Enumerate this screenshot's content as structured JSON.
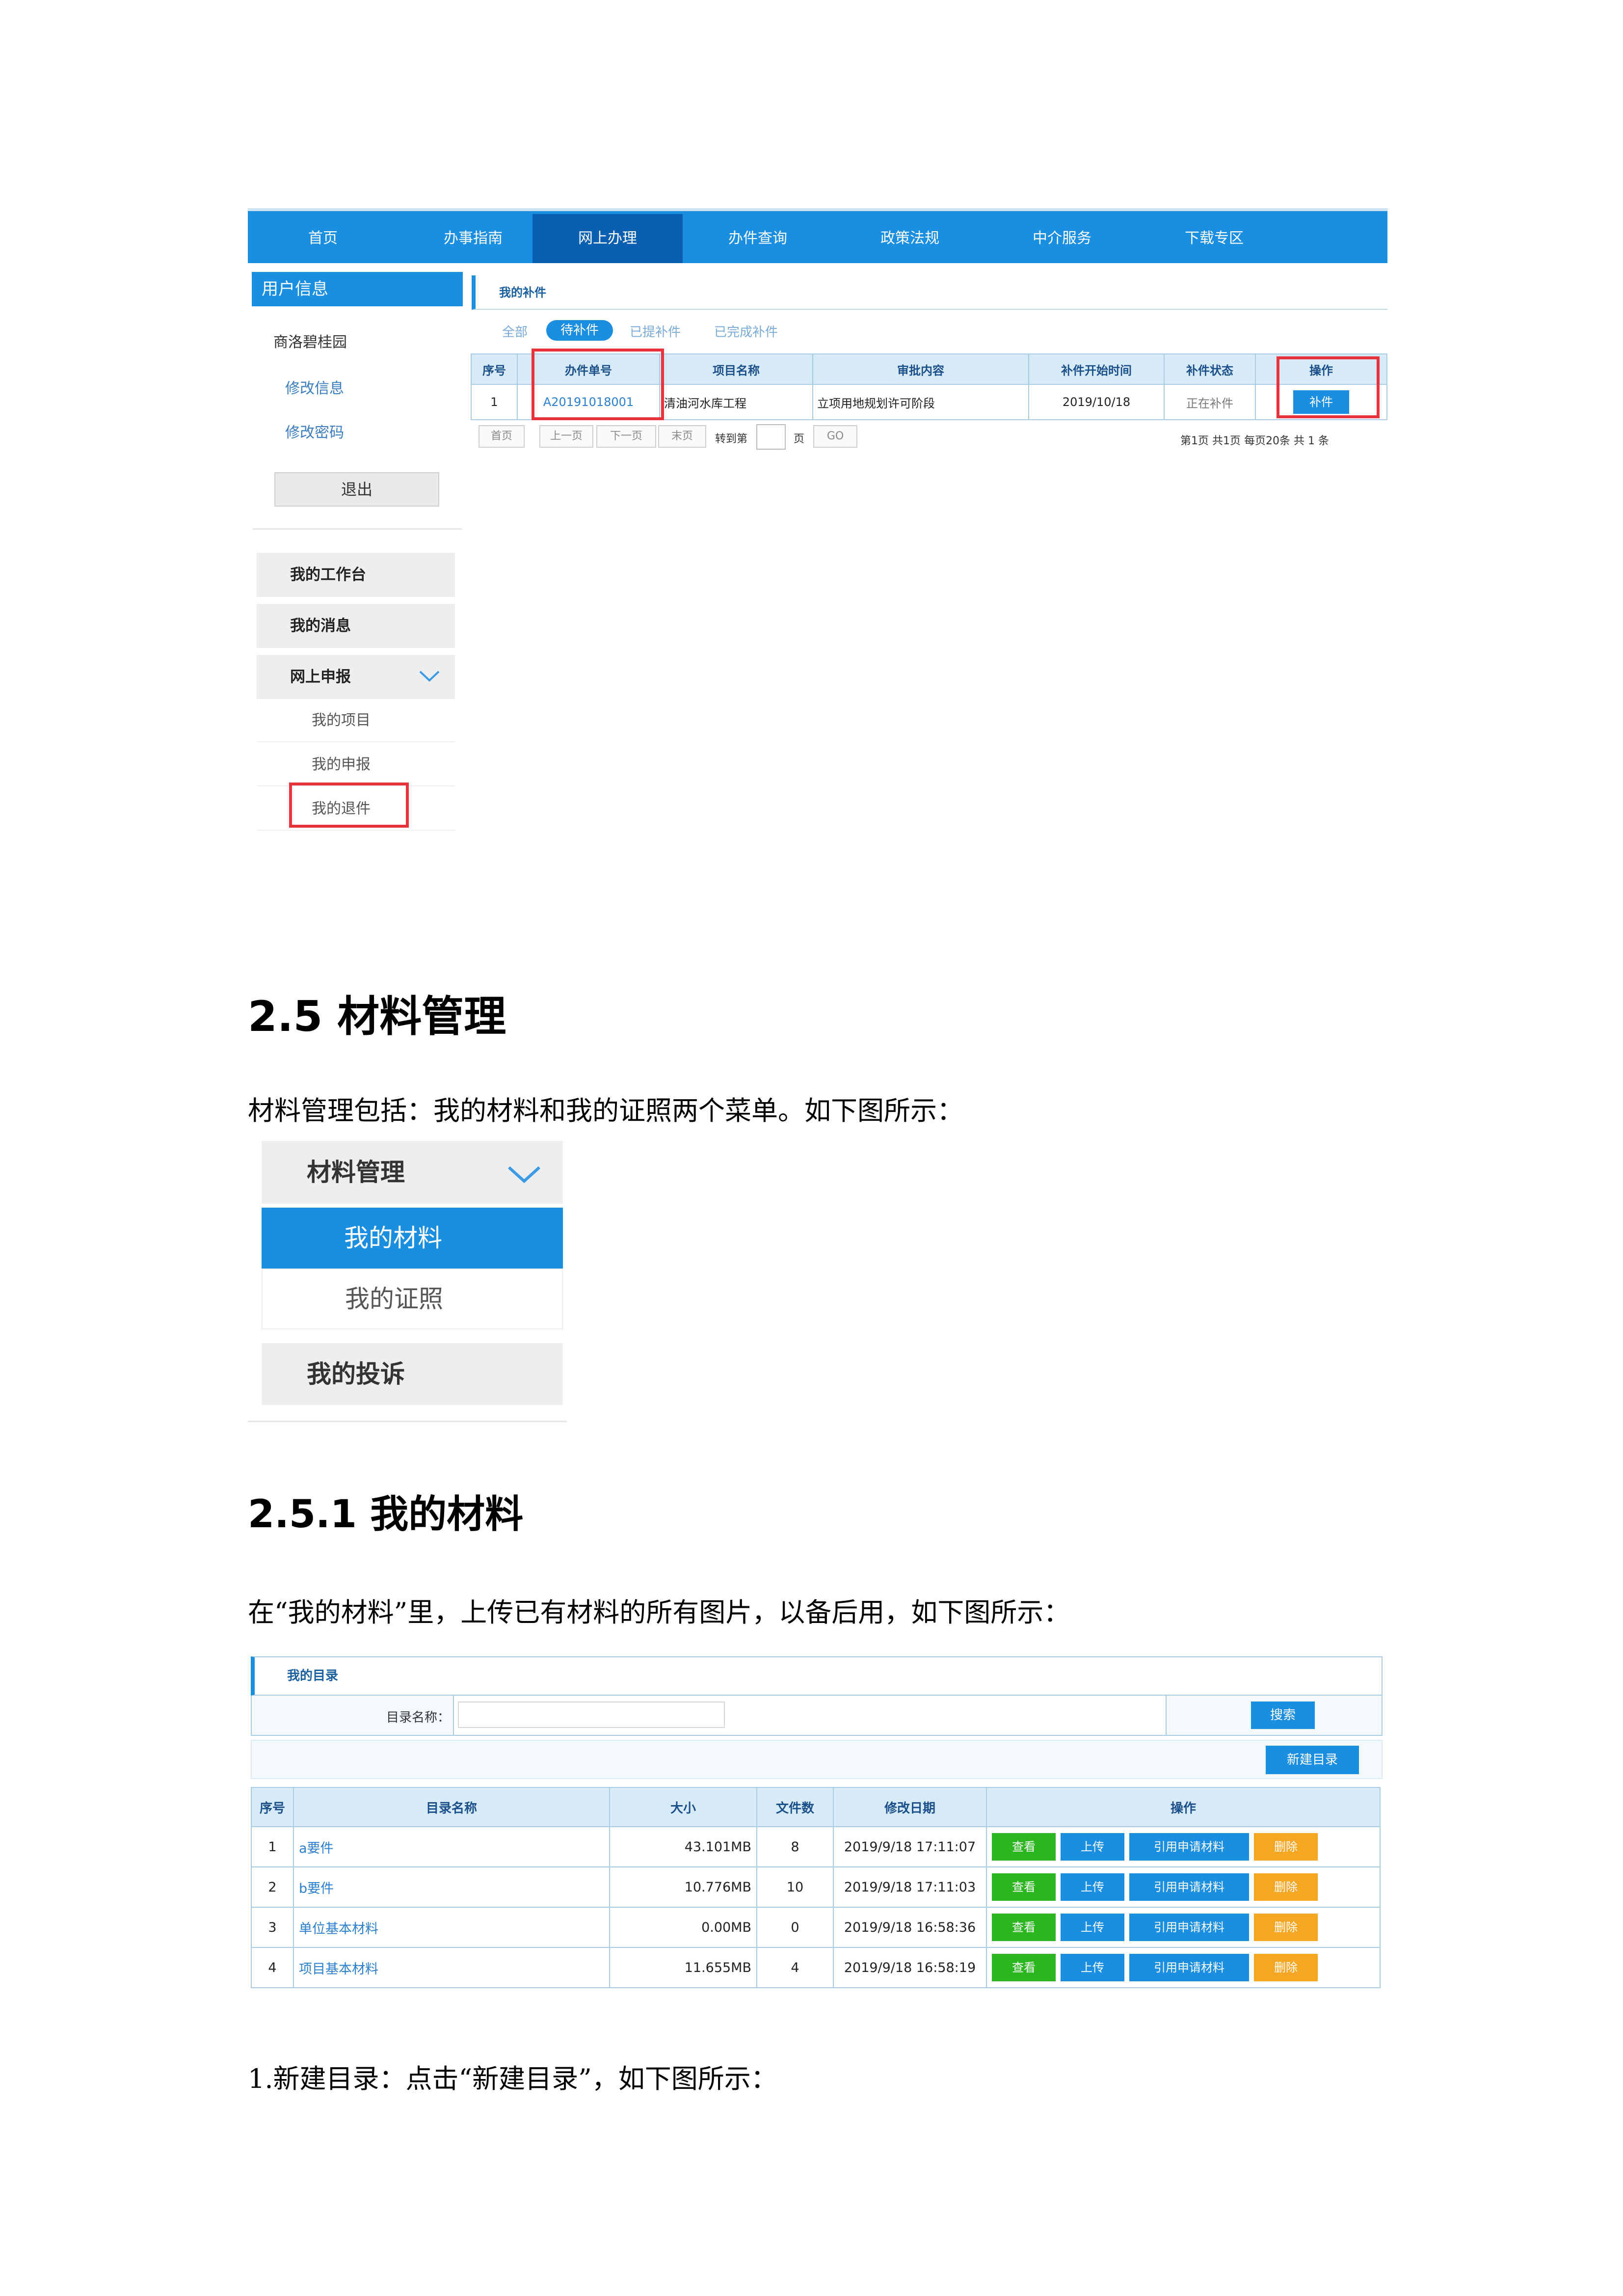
{
  "shot1": {
    "nav": [
      "首页",
      "办事指南",
      "网上办理",
      "办件查询",
      "政策法规",
      "中介服务",
      "下载专区"
    ],
    "user_header": "用户信息",
    "user_name": "商洛碧桂园",
    "modify_info": "修改信息",
    "modify_password": "修改密码",
    "logout": "退出",
    "menu_workbench": "我的工作台",
    "menu_messages": "我的消息",
    "menu_online": "网上申报",
    "sub_projects": "我的项目",
    "sub_declarations": "我的申报",
    "sub_returns": "我的退件",
    "panel_title": "我的补件",
    "filter_all": "全部",
    "filter_pending": "待补件",
    "filter_submitted": "已提补件",
    "filter_done": "已完成补件",
    "table_headers": [
      "序号",
      "办件单号",
      "项目名称",
      "审批内容",
      "补件开始时间",
      "补件状态",
      "操作"
    ],
    "row": {
      "no": "1",
      "case_no": "A20191018001",
      "project": "清油河水库工程",
      "content": "立项用地规划许可阶段",
      "start": "2019/10/18",
      "status": "正在补件",
      "action": "补件"
    },
    "pager": {
      "first": "首页",
      "prev": "上一页",
      "next": "下一页",
      "last": "末页",
      "goto": "转到第",
      "page": "页",
      "go": "GO",
      "summary": "第1页 共1页 每页20条 共 1 条"
    }
  },
  "sec25_title": "2.5 材料管理",
  "sec25_para": "材料管理包括：我的材料和我的证照两个菜单。如下图所示：",
  "shot2": {
    "header": "材料管理",
    "item_active": "我的材料",
    "item_2": "我的证照",
    "complaints": "我的投诉"
  },
  "sec251_title": "2.5.1 我的材料",
  "sec251_para": "在“我的材料”里，上传已有材料的所有图片，以备后用，如下图所示：",
  "shot3": {
    "panel_title": "我的目录",
    "search_label": "目录名称：",
    "search_btn": "搜索",
    "new_dir_btn": "新建目录",
    "headers": [
      "序号",
      "目录名称",
      "大小",
      "文件数",
      "修改日期",
      "操作"
    ],
    "rows": [
      {
        "no": "1",
        "name": "a要件",
        "size": "43.101MB",
        "count": "8",
        "date": "2019/9/18 17:11:07"
      },
      {
        "no": "2",
        "name": "b要件",
        "size": "10.776MB",
        "count": "10",
        "date": "2019/9/18 17:11:03"
      },
      {
        "no": "3",
        "name": "单位基本材料",
        "size": "0.00MB",
        "count": "0",
        "date": "2019/9/18 16:58:36"
      },
      {
        "no": "4",
        "name": "项目基本材料",
        "size": "11.655MB",
        "count": "4",
        "date": "2019/9/18 16:58:19"
      }
    ],
    "op_view": "查看",
    "op_upload": "上传",
    "op_cite": "引用申请材料",
    "op_delete": "删除"
  },
  "step1": "1.新建目录：点击“新建目录”，如下图所示：",
  "colors": {
    "accent": "#1a8ee0",
    "nav_active": "#0a5fb0",
    "highlight": "#e8323c",
    "green": "#2bb51f",
    "orange": "#f5a623"
  }
}
